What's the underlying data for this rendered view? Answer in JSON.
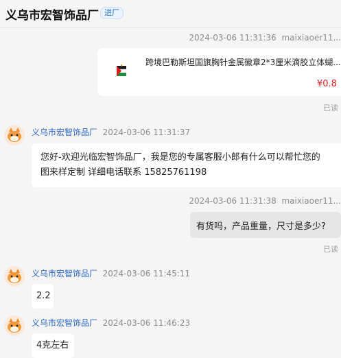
{
  "header": {
    "title": "义乌市宏智饰品厂",
    "badge": "进厂"
  },
  "messages": [
    {
      "time": "2024-03-06 11:31:36",
      "sender": "maixiaoer11...",
      "read": "已读",
      "product": {
        "title": "跨境巴勒斯坦国旗胸针金属徽章2*3厘米滴胶立体蝴...",
        "price": "¥0.8"
      }
    },
    {
      "sender": "义乌市宏智饰品厂",
      "time": "2024-03-06 11:31:37",
      "line1": "您好-欢迎光临宏智饰品厂，我是您的专属客服小郎有什么可以帮忙您的",
      "line2": "图来样定制 详细电话联系 15825761198"
    },
    {
      "time": "2024-03-06 11:31:38",
      "sender": "maixiaoer11...",
      "text": "有货吗，产品重量，尺寸是多少?",
      "read": "已读"
    },
    {
      "sender": "义乌市宏智饰品厂",
      "time": "2024-03-06 11:45:11",
      "text": "2.2"
    },
    {
      "sender": "义乌市宏智饰品厂",
      "time": "2024-03-06 11:46:23",
      "text": "4克左右"
    }
  ],
  "colors": {
    "name_link": "#2a66c4",
    "price": "#e02020",
    "badge": "#1f6fd1"
  },
  "icons": {
    "avatar": "orange-cat-avatar-icon",
    "product_image": "palestine-flag-pin-icon"
  }
}
